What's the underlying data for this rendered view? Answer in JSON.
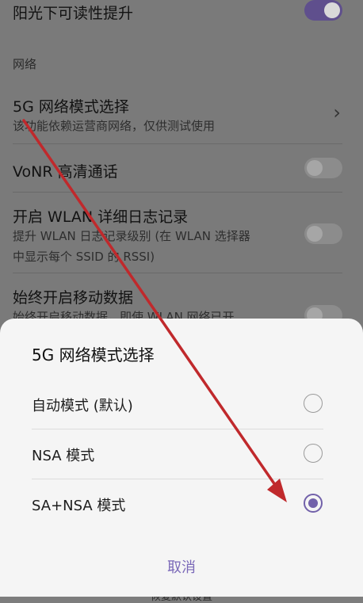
{
  "settings": {
    "sunlight": {
      "title": "阳光下可读性提升",
      "toggle_on": true
    },
    "section_network": "网络",
    "mode5g": {
      "title": "5G 网络模式选择",
      "subtitle": "该功能依赖运营商网络，仅供测试使用"
    },
    "vonr": {
      "title": "VoNR 高清通话",
      "toggle_on": false
    },
    "wlan_log": {
      "title": "开启 WLAN 详细日志记录",
      "subtitle_line1": "提升 WLAN 日志记录级别 (在 WLAN 选择器",
      "subtitle_line2": "中显示每个 SSID 的 RSSI)",
      "toggle_on": false
    },
    "mobile_data": {
      "title": "始终开启移动数据",
      "subtitle": "始终开启移动数据，即使 WLAN 网络已开",
      "toggle_on": false
    }
  },
  "dialog": {
    "title": "5G 网络模式选择",
    "options": [
      {
        "label": "自动模式 (默认)",
        "selected": false
      },
      {
        "label": "NSA 模式",
        "selected": false
      },
      {
        "label": "SA+NSA 模式",
        "selected": true
      }
    ],
    "cancel_label": "取消"
  },
  "peek_text": "恢复默认设置",
  "colors": {
    "accent": "#7261aa",
    "annotation_arrow": "#c0292c"
  }
}
